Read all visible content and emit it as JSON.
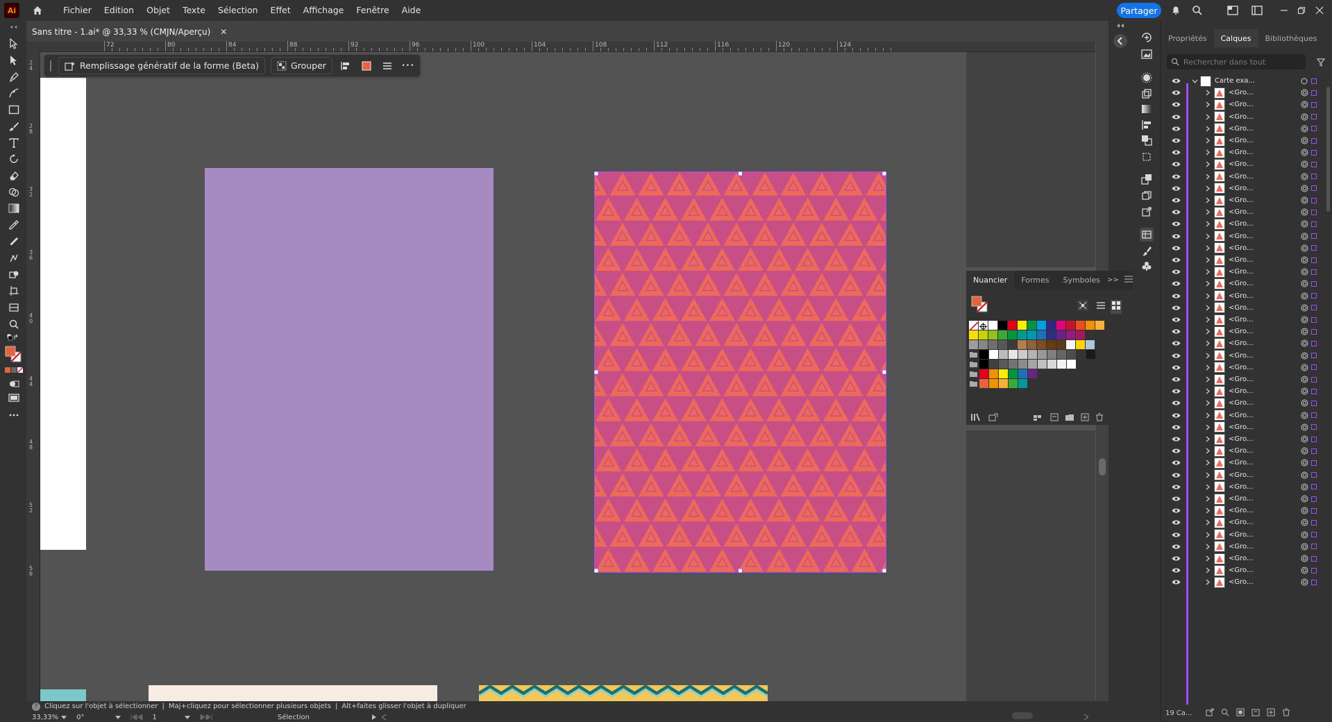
{
  "app": {
    "logo": "Ai",
    "menu": [
      "Fichier",
      "Edition",
      "Objet",
      "Texte",
      "Sélection",
      "Effet",
      "Affichage",
      "Fenêtre",
      "Aide"
    ],
    "share_label": "Partager",
    "accent": "#1473e6"
  },
  "document": {
    "tab_title": "Sans titre - 1.ai* @ 33,33 % (CMJN/Aperçu)",
    "close_glyph": "✕"
  },
  "ruler": {
    "h_labels": [
      "72",
      "80",
      "84",
      "88",
      "92",
      "96",
      "100",
      "104",
      "108",
      "112",
      "116",
      "120",
      "124"
    ],
    "v_labels": [
      [
        "2",
        "4"
      ],
      [
        "2",
        "8"
      ],
      [
        "3",
        "2"
      ],
      [
        "3",
        "6"
      ],
      [
        "4",
        "0"
      ],
      [
        "4",
        "4"
      ],
      [
        "4",
        "8"
      ],
      [
        "5",
        "2"
      ],
      [
        "5",
        "6"
      ]
    ]
  },
  "contextual_bar": {
    "generative_fill_label": "Remplissage génératif de la forme (Beta)",
    "group_label": "Grouper",
    "more_glyph": "•••"
  },
  "colors": {
    "pattern_orange": "#ed6a5a",
    "pattern_bg": "#c84f86",
    "artboard_purple": "#a68bc3",
    "selection": "#a04cff",
    "fill_swatch": "#e8633b"
  },
  "status": {
    "hint_icon": "?",
    "hints": [
      "Cliquez sur l'objet à sélectionner",
      "Maj+cliquez pour sélectionner plusieurs objets",
      "Alt+faites glisser l'objet à dupliquer"
    ],
    "separator": "|",
    "zoom": "33,33%",
    "rotation": "0°",
    "artboard_number": "1",
    "tool_name": "Sélection"
  },
  "swatches_panel": {
    "tabs": [
      "Nuancier",
      "Formes",
      "Symboles"
    ],
    "expand_glyph": ">>",
    "rows": [
      [
        "none",
        "reg",
        "#ffffff",
        "#000000",
        "#e2001a",
        "#ffed00",
        "#009640",
        "#009fe3",
        "#312783",
        "#e6007e",
        "#c4132b",
        "#e94e1b",
        "#f39200",
        "#f9b233"
      ],
      [
        "#f8de00",
        "#c8d400",
        "#95c11f",
        "#3aaa35",
        "#00983a",
        "#009b90",
        "#0099b4",
        "#1d71b8",
        "#2d2e83",
        "#662483",
        "#951b81",
        "#a3195b"
      ],
      [
        "#9d9d9c",
        "#878787",
        "#706f6f",
        "#575756",
        "#3c3c3b",
        "#b17f4a",
        "#936037",
        "#7d4e24",
        "#683c11",
        "#5a3a1a",
        "#f5f5f5",
        "#ffd500",
        "#b0c4de"
      ],
      [
        "#000000",
        "#ffffff",
        "#bbbbbb",
        "#e6e6e6",
        "#cccccc",
        "#b3b3b3",
        "#999999",
        "#808080",
        "#666666",
        "#4d4d4d",
        "#333333",
        "#1a1a1a"
      ],
      [
        "#000000",
        "#404040",
        "#595959",
        "#737373",
        "#8c8c8c",
        "#a6a6a6",
        "#bfbfbf",
        "#d9d9d9",
        "#f2f2f2",
        "#ffffff"
      ],
      [
        "#e2001a",
        "#f39200",
        "#ffed00",
        "#009640",
        "#1d71b8",
        "#662483"
      ],
      [
        "#e8633b",
        "#f39200",
        "#f9b233",
        "#3aaa35",
        "#00989a"
      ]
    ]
  },
  "layers_panel": {
    "tabs": [
      "Propriétés",
      "Calques",
      "Bibliothèques"
    ],
    "search_placeholder": "Rechercher dans tout",
    "root_layer": "Carte exa...",
    "group_label": "<Gro...",
    "group_count": 42,
    "footer_count": "19 Ca..."
  }
}
